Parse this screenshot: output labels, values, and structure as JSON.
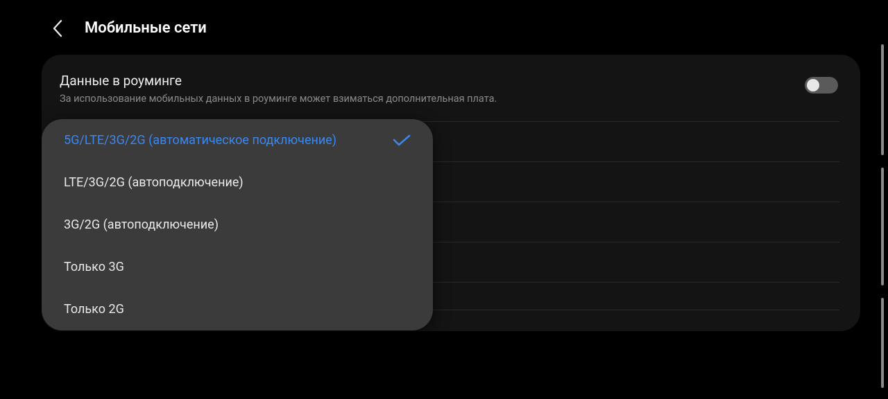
{
  "header": {
    "title": "Мобильные сети"
  },
  "roaming": {
    "title": "Данные в роуминге",
    "desc": "За использование мобильных данных в роуминге может взиматься дополнительная плата."
  },
  "network_mode_options": [
    "5G/LTE/3G/2G (автоматическое подключение)",
    "LTE/3G/2G (автоподключение)",
    "3G/2G (автоподключение)",
    "Только 3G",
    "Только 2G"
  ],
  "colors": {
    "accent": "#3b87f0"
  }
}
